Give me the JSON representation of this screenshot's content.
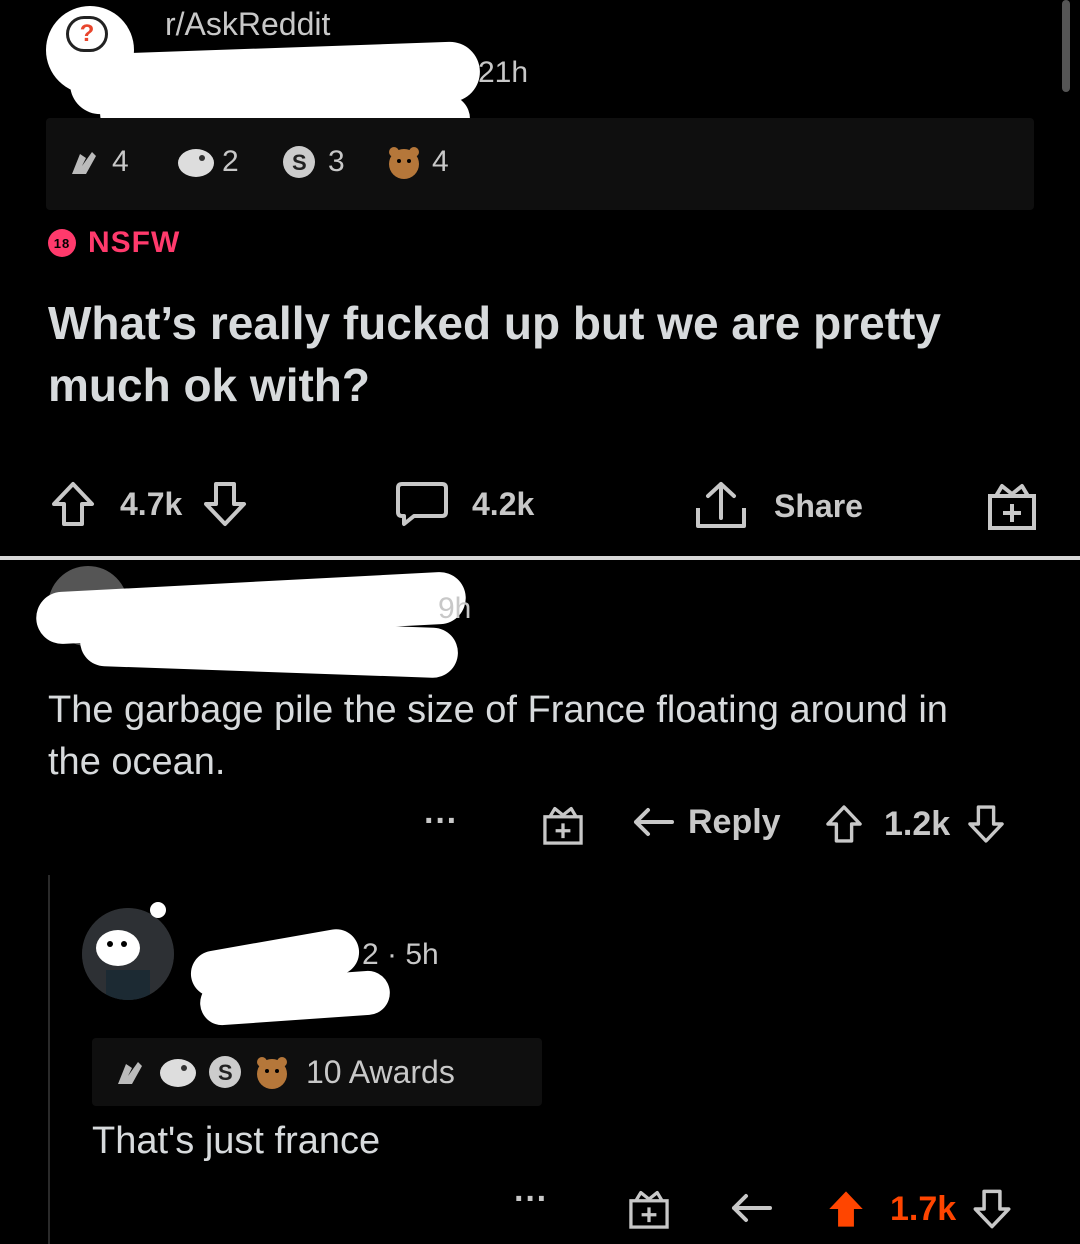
{
  "post": {
    "subreddit": "r/AskReddit",
    "time": "21h",
    "awards": [
      {
        "icon": "salute-hands-icon",
        "count": "4"
      },
      {
        "icon": "wholesome-face-icon",
        "count": "2"
      },
      {
        "icon": "silver-coin-icon",
        "count": "3"
      },
      {
        "icon": "bear-hug-icon",
        "count": "4"
      }
    ],
    "nsfw_badge": "18",
    "nsfw_label": "NSFW",
    "title": "What’s really fucked up but we are pretty much ok with?",
    "upvotes": "4.7k",
    "comments": "4.2k",
    "share": "Share"
  },
  "comment": {
    "time": "9h",
    "text": "The garbage pile the size of France floating around in the ocean.",
    "more": "···",
    "reply": "Reply",
    "score": "1.2k"
  },
  "reply": {
    "meta": "2 · 5h",
    "awards_label": "10 Awards",
    "text": "That's just france",
    "more": "···",
    "score": "1.7k",
    "upvote_color": "#ff4500",
    "score_color": "#ff4500"
  }
}
